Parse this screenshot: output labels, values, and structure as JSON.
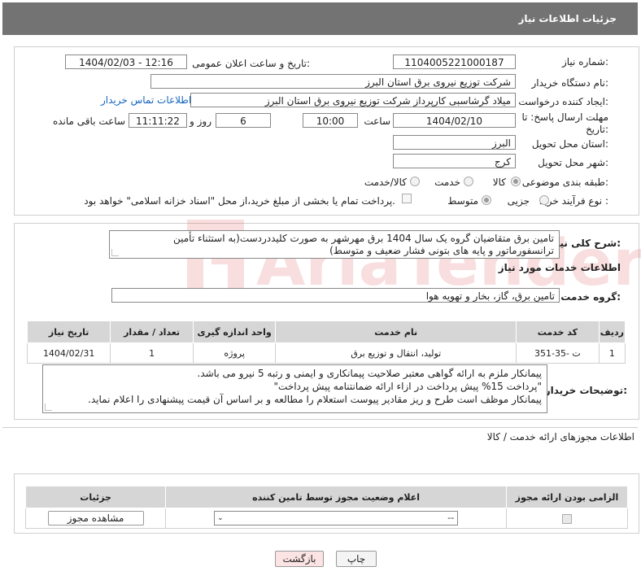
{
  "header": {
    "title": "جزئیات اطلاعات نیاز"
  },
  "form": {
    "need_number_label": "شماره نیاز:",
    "need_number": "1104005221000187",
    "announce_label": "تاریخ و ساعت اعلان عمومی:",
    "announce_value": "1404/02/03 - 12:16",
    "buyer_org_label": "نام دستگاه خریدار:",
    "buyer_org": "شرکت توزیع نیروی برق استان البرز",
    "creator_label": "ایجاد کننده درخواست:",
    "creator": "میلاد گرشاسبی کارپرداز شرکت توزیع نیروی برق استان البرز",
    "contact_link": "اطلاعات تماس خریدار",
    "deadline_label_1": "مهلت ارسال پاسخ: تا",
    "deadline_label_2": "تاریخ:",
    "deadline_date": "1404/02/10",
    "time_label": "ساعت",
    "deadline_time": "10:00",
    "days_value": "6",
    "days_label": "روز و",
    "remaining_time": "11:11:22",
    "remaining_label": "ساعت باقی مانده",
    "province_label": "استان محل تحویل:",
    "province": "البرز",
    "city_label": "شهر محل تحویل:",
    "city": "کرج",
    "category_label": "طبقه بندی موضوعی:",
    "category_options": [
      "کالا",
      "خدمت",
      "کالا/خدمت"
    ],
    "process_label": "نوع فرآیند خرید :",
    "process_options": [
      "جزیی",
      "متوسط"
    ],
    "payment_note": "پرداخت تمام یا بخشی از مبلغ خرید،از محل \"اسناد خزانه اسلامی\" خواهد بود."
  },
  "summary": {
    "label": "شرح کلی نیاز:",
    "text": "تامین برق متقاضیان گروه یک سال 1404 برق مهرشهر به صورت کلیددردست(به استثناء تأمین ترانسفورماتور و پایه های بتونی فشار ضعیف و متوسط)"
  },
  "services": {
    "section_title": "اطلاعات خدمات مورد نیاز",
    "group_label": "گروه خدمت:",
    "group_value": "تامین برق، گاز، بخار و تهویه هوا",
    "columns": [
      "ردیف",
      "کد خدمت",
      "نام خدمت",
      "واحد اندازه گیری",
      "تعداد / مقدار",
      "تاریخ نیاز"
    ],
    "rows": [
      [
        "1",
        "ت -35-351",
        "تولید، انتقال و توزیع برق",
        "پروژه",
        "1",
        "1404/02/31"
      ]
    ]
  },
  "buyer_notes": {
    "label": "توضیحات خریدار:",
    "lines": [
      "پیمانکار ملزم به ارائه گواهی معتبر صلاحیت پیمانکاری و ایمنی و رتبه 5 نیرو می باشد.",
      "\"پرداخت 15% پیش پرداخت در ازاء ارائه ضمانتنامه پیش پرداخت\"",
      "پیمانکار موظف است طرح و ریز مقادیر پیوست استعلام را مطالعه و بر اساس آن قیمت پیشنهادی را اعلام نماید."
    ]
  },
  "permits": {
    "title": "اطلاعات مجوزهای ارائه خدمت / کالا",
    "columns": [
      "الزامی بودن ارائه مجوز",
      "اعلام وضعیت مجوز توسط تامین کننده",
      "جزئیات"
    ],
    "select_value": "--",
    "view_button": "مشاهده مجوز"
  },
  "footer": {
    "print": "چاپ",
    "back": "بازگشت"
  },
  "watermark": {
    "text": "AriaTender.neT"
  },
  "colors": {
    "header_bg": "#737373",
    "link": "#1565c0",
    "back_bg": "#fde4e4",
    "watermark": "#e46b6b"
  }
}
